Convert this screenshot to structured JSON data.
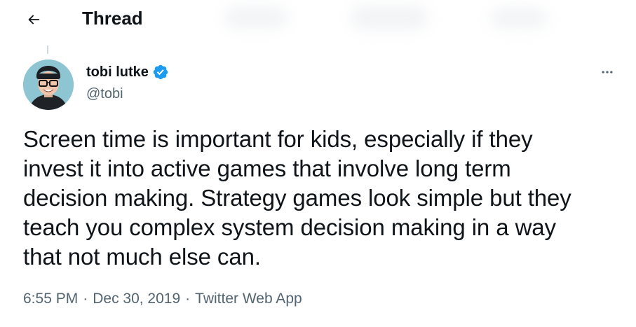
{
  "header": {
    "back_icon": "arrow-left-icon",
    "title": "Thread"
  },
  "tweet": {
    "author": {
      "name": "tobi lutke",
      "handle": "@tobi",
      "verified": true,
      "verified_icon": "verified-badge-icon",
      "avatar": "avatar-photo"
    },
    "more_icon": "more-horizontal-icon",
    "text": "Screen time is important for kids, especially if they\ninvest it into active games that involve long term\ndecision making. Strategy games look simple but they\nteach you complex system decision making in a way\nthat not much else can.",
    "time": "6:55 PM",
    "date": "Dec 30, 2019",
    "source": "Twitter Web App",
    "separator": "·"
  },
  "colors": {
    "text_primary": "#0f1419",
    "text_secondary": "#536471",
    "verified_blue": "#1d9bf0",
    "background": "#ffffff"
  }
}
